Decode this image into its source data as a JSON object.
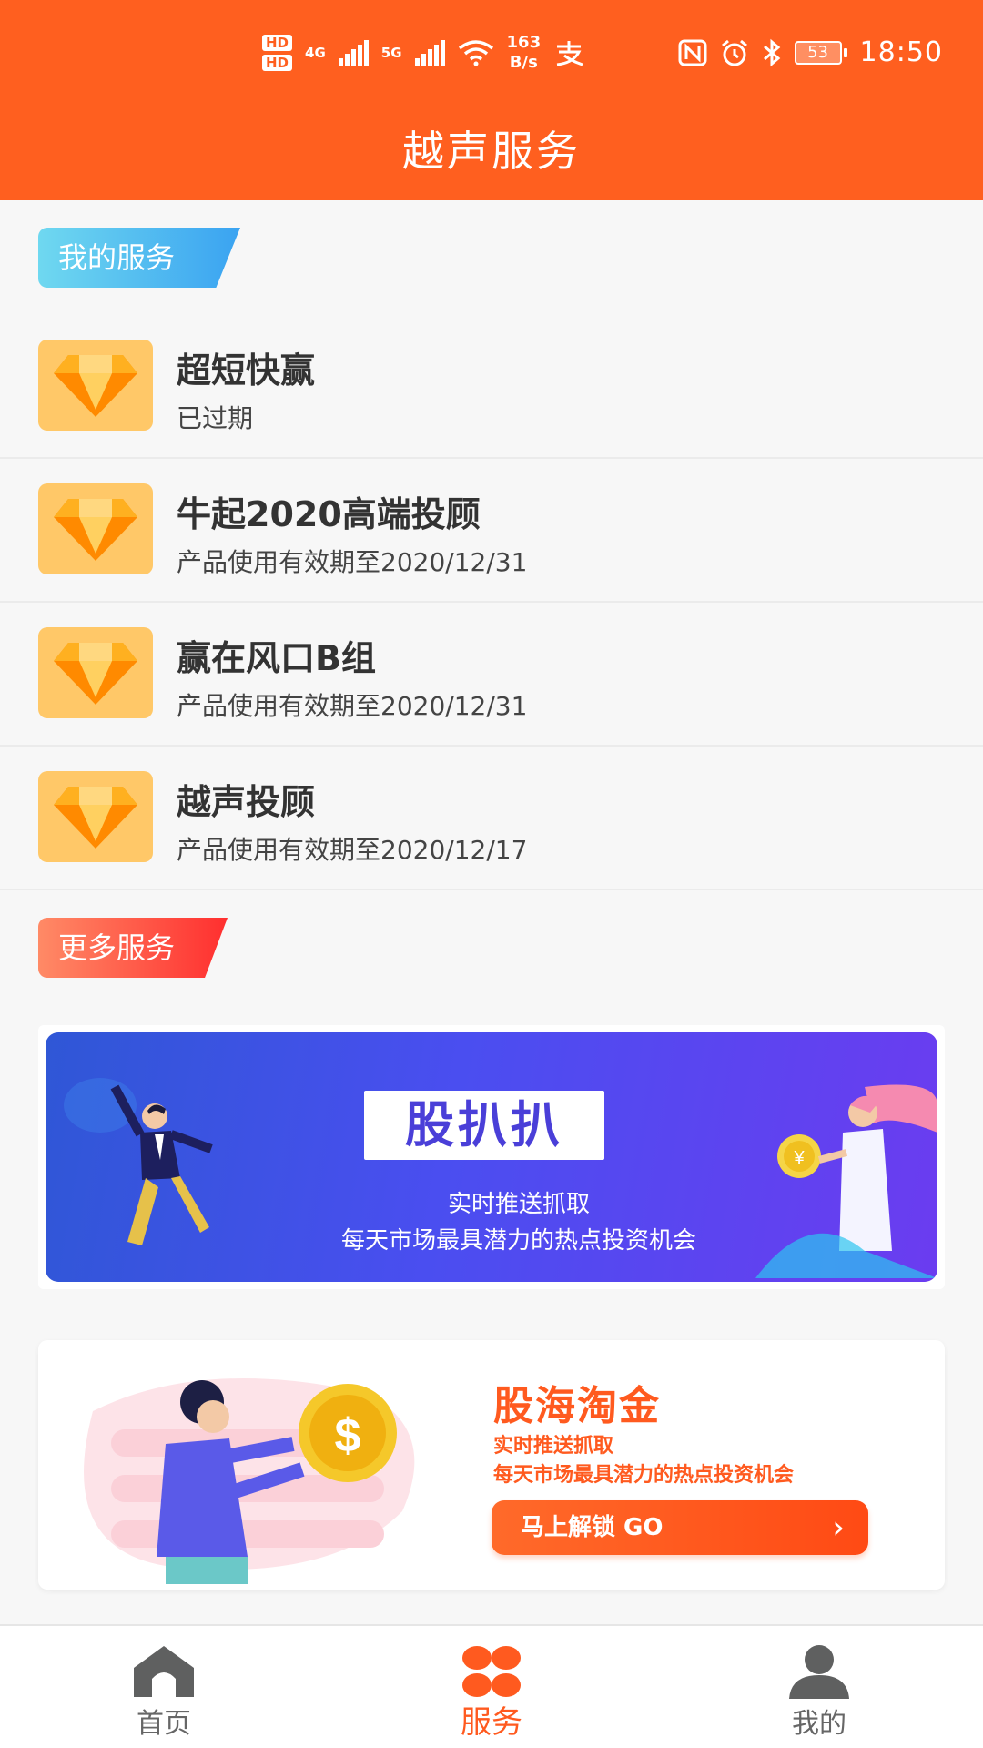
{
  "status_bar": {
    "hd1": "HD",
    "hd2": "HD",
    "net1": "4G",
    "net2": "5G",
    "speed_value": "163",
    "speed_unit": "B/s",
    "battery": "53",
    "time": "18:50"
  },
  "header": {
    "title": "越声服务"
  },
  "my_services": {
    "tag": "我的服务",
    "items": [
      {
        "title": "超短快赢",
        "subtitle": "已过期"
      },
      {
        "title": "牛起2020高端投顾",
        "subtitle": "产品使用有效期至2020/12/31"
      },
      {
        "title": "赢在风口B组",
        "subtitle": "产品使用有效期至2020/12/31"
      },
      {
        "title": "越声投顾",
        "subtitle": "产品使用有效期至2020/12/17"
      }
    ]
  },
  "more_services": {
    "tag": "更多服务",
    "banner1": {
      "title": "股扒扒",
      "line1": "实时推送抓取",
      "line2": "每天市场最具潜力的热点投资机会"
    },
    "banner2": {
      "title": "股海淘金",
      "line1": "实时推送抓取",
      "line2": "每天市场最具潜力的热点投资机会",
      "button": "马上解锁 GO",
      "coin_symbol": "$"
    }
  },
  "bottom_nav": {
    "home": "首页",
    "service": "服务",
    "mine": "我的"
  },
  "colors": {
    "brand": "#ff5f1f",
    "icon_bg": "#ffc868",
    "text": "#333333"
  }
}
